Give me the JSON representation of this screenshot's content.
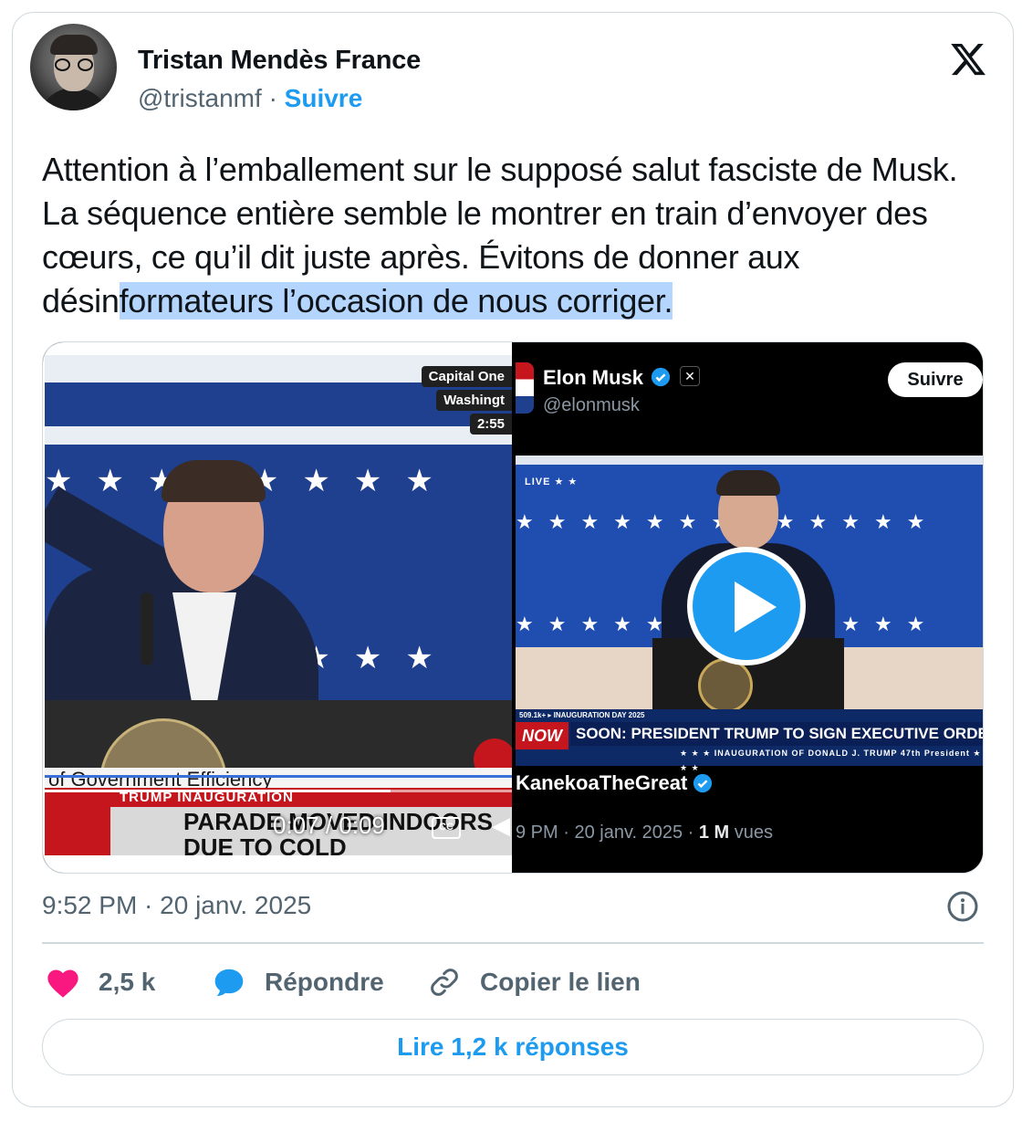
{
  "author": {
    "name": "Tristan Mendès France",
    "handle": "@tristanmf",
    "separator": "·",
    "follow_label": "Suivre"
  },
  "tweet": {
    "text_plain": "Attention à l’emballement sur le supposé salut fasciste de Musk. La séquence entière semble le montrer en train d’envoyer des cœurs, ce qu’il dit juste après. Évitons de donner aux désin",
    "text_highlighted": "formateurs l’occasion de nous corriger."
  },
  "media": {
    "left_video": {
      "badge_line1": "Capital One",
      "badge_line2": "Washingt",
      "badge_line3": "2:55",
      "lower_third": "of Government Efficiency",
      "news_top": "TRUMP INAUGURATION",
      "news_line1": "PARADE MOVED INDOORS",
      "news_line2": "DUE TO COLD",
      "timecode": "0:07 / 0:09",
      "cc_label": "CC",
      "side_tag": "INAU",
      "side_time": "2:5",
      "progress": 0.74
    },
    "right_quote": {
      "name": "Elon Musk",
      "handle": "@elonmusk",
      "follow_label": "Suivre",
      "live_label": "LIVE ★ ★",
      "ticker_top": "509.1k+  ▸ INAUGURATION DAY 2025",
      "ticker_now": "NOW",
      "ticker_main": "SOON: PRESIDENT TRUMP TO SIGN EXECUTIVE ORDERS",
      "ticker_sub": "★ ★ ★  INAUGURATION OF DONALD J. TRUMP  47th President  ★ ★ ★",
      "quoted_author": "KanekoaTheGreat",
      "meta_time": "9 PM · 20 janv. 2025 · ",
      "meta_views_count": "1 M",
      "meta_views_label": " vues"
    }
  },
  "timestamp": "9:52 PM · 20 janv. 2025",
  "actions": {
    "like_count": "2,5 k",
    "reply_label": "Répondre",
    "copy_label": "Copier le lien"
  },
  "read_replies_label": "Lire 1,2 k réponses",
  "colors": {
    "accent": "#1d9bf0",
    "like": "#f91880",
    "text": "#0f1419",
    "secondary": "#536471",
    "border": "#cfd9de",
    "highlight": "#b4d5fe"
  },
  "icons": [
    "x-logo-icon",
    "verified-icon",
    "play-icon",
    "info-icon",
    "heart-icon",
    "reply-bubble-icon",
    "link-icon"
  ]
}
